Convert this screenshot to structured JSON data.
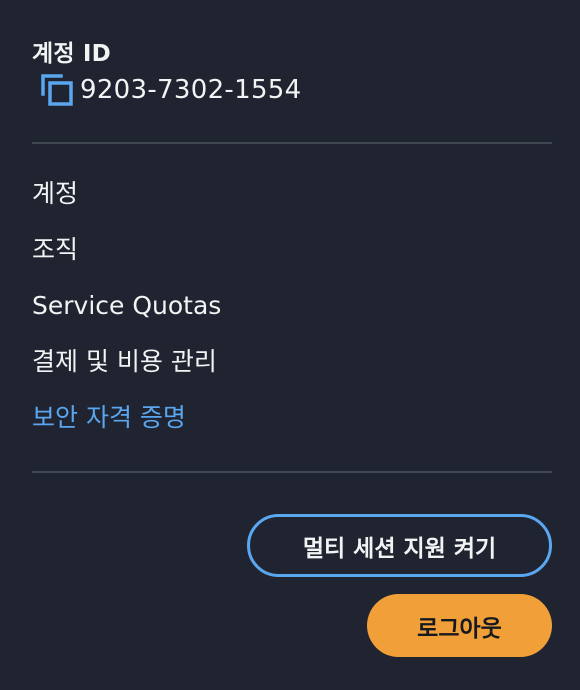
{
  "account": {
    "label": "계정 ID",
    "id_value": "9203-7302-1554",
    "copy_icon": "copy-icon"
  },
  "menu": {
    "items": [
      {
        "label": "계정",
        "active": false
      },
      {
        "label": "조직",
        "active": false
      },
      {
        "label": "Service Quotas",
        "active": false
      },
      {
        "label": "결제 및 비용 관리",
        "active": false
      },
      {
        "label": "보안 자격 증명",
        "active": true
      }
    ]
  },
  "actions": {
    "multi_session_label": "멀티 세션 지원 켜기",
    "logout_label": "로그아웃"
  },
  "colors": {
    "background": "#1f2430",
    "text": "#f2f3f3",
    "link_active": "#5aa7f0",
    "divider": "#414750",
    "logout_bg": "#f19f38",
    "outline_button_border": "#5aa7f0"
  }
}
